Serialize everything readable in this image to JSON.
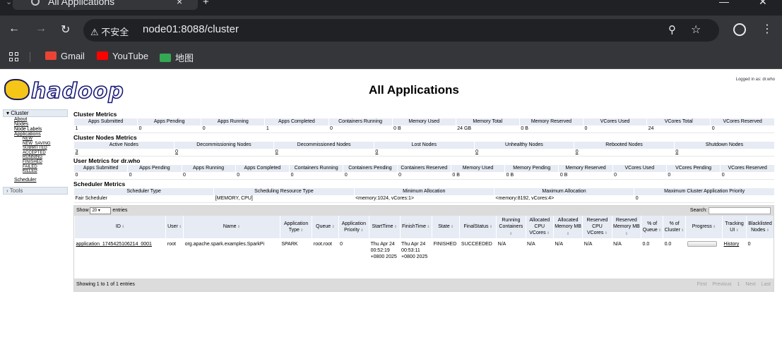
{
  "browser": {
    "tab_title": "All Applications",
    "tab_close": "×",
    "new_tab": "+",
    "security_label": "⚠ 不安全",
    "url": "node01:8088/cluster",
    "bookmarks": [
      {
        "label": "Gmail",
        "color": "#ea4335"
      },
      {
        "label": "YouTube",
        "color": "#ff0000"
      },
      {
        "label": "地图",
        "color": "#34a853"
      }
    ]
  },
  "header": {
    "logo_text": "hadoop",
    "title": "All Applications",
    "logged_in": "Logged in as: dr.who"
  },
  "sidebar": {
    "cluster_label": "▾ Cluster",
    "cluster_items": [
      "About",
      "Nodes",
      "Node Labels",
      "Applications"
    ],
    "app_states": [
      "NEW",
      "NEW_SAVING",
      "SUBMITTED",
      "ACCEPTED",
      "RUNNING",
      "FINISHED",
      "FAILED",
      "KILLED"
    ],
    "scheduler": "Scheduler",
    "tools_label": "› Tools"
  },
  "cluster_metrics": {
    "title": "Cluster Metrics",
    "headers": [
      "Apps Submitted",
      "Apps Pending",
      "Apps Running",
      "Apps Completed",
      "Containers Running",
      "Memory Used",
      "Memory Total",
      "Memory Reserved",
      "VCores Used",
      "VCores Total",
      "VCores Reserved"
    ],
    "values": [
      "1",
      "0",
      "0",
      "1",
      "0",
      "0 B",
      "24 GB",
      "0 B",
      "0",
      "24",
      "0"
    ]
  },
  "node_metrics": {
    "title": "Cluster Nodes Metrics",
    "headers": [
      "Active Nodes",
      "Decommissioning Nodes",
      "Decommissioned Nodes",
      "Lost Nodes",
      "Unhealthy Nodes",
      "Rebooted Nodes",
      "Shutdown Nodes"
    ],
    "values": [
      "3",
      "0",
      "0",
      "0",
      "0",
      "0",
      "0"
    ]
  },
  "user_metrics": {
    "title": "User Metrics for dr.who",
    "headers": [
      "Apps Submitted",
      "Apps Pending",
      "Apps Running",
      "Apps Completed",
      "Containers Running",
      "Containers Pending",
      "Containers Reserved",
      "Memory Used",
      "Memory Pending",
      "Memory Reserved",
      "VCores Used",
      "VCores Pending",
      "VCores Reserved"
    ],
    "values": [
      "0",
      "0",
      "0",
      "0",
      "0",
      "0",
      "0",
      "0 B",
      "0 B",
      "0 B",
      "0",
      "0",
      "0"
    ]
  },
  "scheduler_metrics": {
    "title": "Scheduler Metrics",
    "headers": [
      "Scheduler Type",
      "Scheduling Resource Type",
      "Minimum Allocation",
      "Maximum Allocation",
      "Maximum Cluster Application Priority"
    ],
    "values": [
      "Fair Scheduler",
      "[MEMORY, CPU]",
      "<memory:1024, vCores:1>",
      "<memory:8192, vCores:4>",
      "0"
    ]
  },
  "apps_table": {
    "show_label": "Show",
    "page_size": "20",
    "entries_label": "entries",
    "search_label": "Search:",
    "headers": [
      "ID",
      "User",
      "Name",
      "Application Type",
      "Queue",
      "Application Priority",
      "StartTime",
      "FinishTime",
      "State",
      "FinalStatus",
      "Running Containers",
      "Allocated CPU VCores",
      "Allocated Memory MB",
      "Reserved CPU VCores",
      "Reserved Memory MB",
      "% of Queue",
      "% of Cluster",
      "Progress",
      "Tracking UI",
      "Blacklisted Nodes"
    ],
    "rows": [
      {
        "id": "application_1745425106214_0001",
        "user": "root",
        "name": "org.apache.spark.examples.SparkPi",
        "type": "SPARK",
        "queue": "root.root",
        "priority": "0",
        "start": "Thu Apr 24 00:52:19 +0800 2025",
        "finish": "Thu Apr 24 00:53:11 +0800 2025",
        "state": "FINISHED",
        "final_status": "SUCCEEDED",
        "running_containers": "N/A",
        "alloc_vcores": "N/A",
        "alloc_mem": "N/A",
        "res_vcores": "N/A",
        "res_mem": "N/A",
        "pct_queue": "0.0",
        "pct_cluster": "0.0",
        "progress": 0,
        "tracking": "History",
        "blacklisted": "0"
      }
    ],
    "footer_info": "Showing 1 to 1 of 1 entries",
    "pager": [
      "First",
      "Previous",
      "1",
      "Next",
      "Last"
    ]
  }
}
